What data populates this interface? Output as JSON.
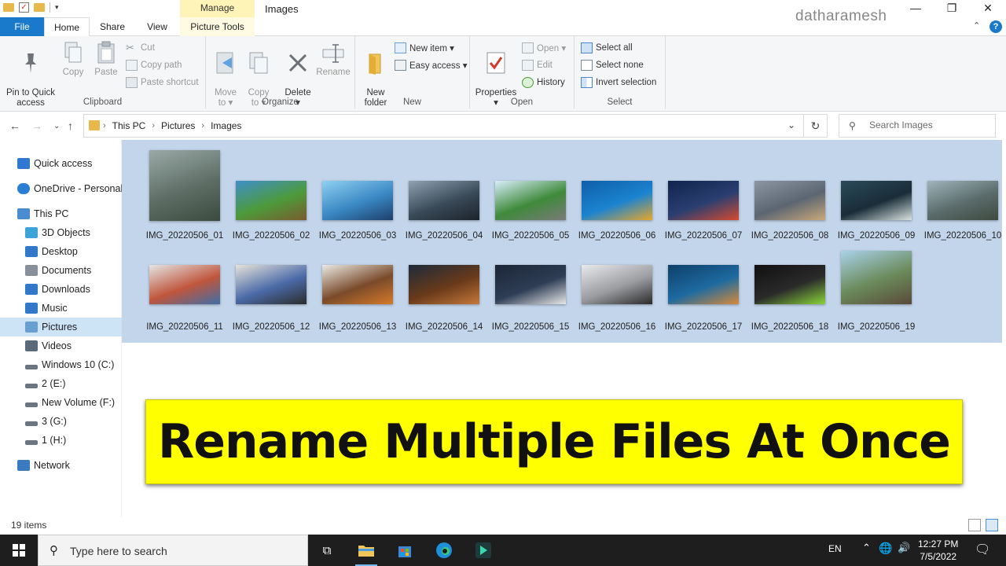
{
  "window": {
    "title": "Images",
    "contextual_group": "Manage",
    "watermark": "datharamesh",
    "minimize": "—",
    "maximize": "❐",
    "close": "✕"
  },
  "tabs": {
    "file": "File",
    "home": "Home",
    "share": "Share",
    "view": "View",
    "picture_tools": "Picture Tools"
  },
  "ribbon": {
    "clipboard": {
      "label": "Clipboard",
      "pin": "Pin to Quick\naccess",
      "copy": "Copy",
      "paste": "Paste",
      "cut": "Cut",
      "copy_path": "Copy path",
      "paste_shortcut": "Paste shortcut"
    },
    "organize": {
      "label": "Organize",
      "move_to": "Move\nto ▾",
      "copy_to": "Copy\nto ▾",
      "delete": "Delete\n▾",
      "rename": "Rename"
    },
    "new": {
      "label": "New",
      "new_folder": "New\nfolder",
      "new_item": "New item ▾",
      "easy_access": "Easy access ▾"
    },
    "open": {
      "label": "Open",
      "properties": "Properties\n▾",
      "open": "Open ▾",
      "edit": "Edit",
      "history": "History"
    },
    "select": {
      "label": "Select",
      "select_all": "Select all",
      "select_none": "Select none",
      "invert": "Invert selection"
    }
  },
  "address": {
    "crumbs": [
      "This PC",
      "Pictures",
      "Images"
    ],
    "search_placeholder": "Search Images"
  },
  "nav_pane": [
    {
      "label": "Quick access",
      "icon": "star-icon",
      "indent": 0,
      "selected": false
    },
    {
      "label": "OneDrive - Personal",
      "icon": "cloud-icon",
      "indent": 0,
      "selected": false
    },
    {
      "label": "This PC",
      "icon": "computer-icon",
      "indent": 0,
      "selected": false
    },
    {
      "label": "3D Objects",
      "icon": "cube-icon",
      "indent": 1,
      "selected": false
    },
    {
      "label": "Desktop",
      "icon": "desktop-icon",
      "indent": 1,
      "selected": false
    },
    {
      "label": "Documents",
      "icon": "document-icon",
      "indent": 1,
      "selected": false
    },
    {
      "label": "Downloads",
      "icon": "download-icon",
      "indent": 1,
      "selected": false
    },
    {
      "label": "Music",
      "icon": "music-icon",
      "indent": 1,
      "selected": false
    },
    {
      "label": "Pictures",
      "icon": "pictures-icon",
      "indent": 1,
      "selected": true
    },
    {
      "label": "Videos",
      "icon": "video-icon",
      "indent": 1,
      "selected": false
    },
    {
      "label": "Windows 10 (C:)",
      "icon": "drive-icon",
      "indent": 1,
      "selected": false
    },
    {
      "label": "2 (E:)",
      "icon": "drive-icon",
      "indent": 1,
      "selected": false
    },
    {
      "label": "New Volume (F:)",
      "icon": "drive-icon",
      "indent": 1,
      "selected": false
    },
    {
      "label": "3 (G:)",
      "icon": "drive-icon",
      "indent": 1,
      "selected": false
    },
    {
      "label": "1 (H:)",
      "icon": "drive-icon",
      "indent": 1,
      "selected": false
    },
    {
      "label": "Network",
      "icon": "network-icon",
      "indent": 0,
      "selected": false
    }
  ],
  "files": [
    {
      "name": "IMG_20220506_01",
      "palette": [
        "#9aa9a6",
        "#5e6e66",
        "#3b4a3e"
      ],
      "portrait": true
    },
    {
      "name": "IMG_20220506_02",
      "palette": [
        "#3f8fc9",
        "#4d9a3a",
        "#7a5a2e"
      ],
      "portrait": false
    },
    {
      "name": "IMG_20220506_03",
      "palette": [
        "#8fd0f2",
        "#3a88c4",
        "#1d3f6b"
      ],
      "portrait": false
    },
    {
      "name": "IMG_20220506_04",
      "palette": [
        "#8ea2b2",
        "#3a4a58",
        "#1b232b"
      ],
      "portrait": false
    },
    {
      "name": "IMG_20220506_05",
      "palette": [
        "#d8eefb",
        "#3f8a3a",
        "#7a7a7a"
      ],
      "portrait": false
    },
    {
      "name": "IMG_20220506_06",
      "palette": [
        "#0f5fa8",
        "#1b83d0",
        "#e7a72a"
      ],
      "portrait": false
    },
    {
      "name": "IMG_20220506_07",
      "palette": [
        "#10244d",
        "#2a3f70",
        "#d64a2f"
      ],
      "portrait": false
    },
    {
      "name": "IMG_20220506_08",
      "palette": [
        "#8c96a2",
        "#5c6672",
        "#c9a87a"
      ],
      "portrait": false
    },
    {
      "name": "IMG_20220506_09",
      "palette": [
        "#2a4a5a",
        "#1a2d38",
        "#d8e2e0"
      ],
      "portrait": false
    },
    {
      "name": "IMG_20220506_10",
      "palette": [
        "#9fb4bc",
        "#5a6b6a",
        "#3e4a40"
      ],
      "portrait": false
    },
    {
      "name": "IMG_20220506_11",
      "palette": [
        "#e5e5e5",
        "#c0563c",
        "#3f6ea8"
      ],
      "portrait": false
    },
    {
      "name": "IMG_20220506_12",
      "palette": [
        "#e6e3da",
        "#4a6aa8",
        "#2c2c2c"
      ],
      "portrait": false
    },
    {
      "name": "IMG_20220506_13",
      "palette": [
        "#eaeae4",
        "#7a4a2a",
        "#d67a2a"
      ],
      "portrait": false
    },
    {
      "name": "IMG_20220506_14",
      "palette": [
        "#1c2a3a",
        "#6a3a1a",
        "#c6783a"
      ],
      "portrait": false
    },
    {
      "name": "IMG_20220506_15",
      "palette": [
        "#1b2536",
        "#2e3d55",
        "#e8e8e8"
      ],
      "portrait": false
    },
    {
      "name": "IMG_20220506_16",
      "palette": [
        "#e9eaec",
        "#9a9ca0",
        "#2a2a2a"
      ],
      "portrait": false
    },
    {
      "name": "IMG_20220506_17",
      "palette": [
        "#0f3f6a",
        "#1d6aa0",
        "#d68a3a"
      ],
      "portrait": false
    },
    {
      "name": "IMG_20220506_18",
      "palette": [
        "#101010",
        "#2a2a2a",
        "#8ad43a"
      ],
      "portrait": false
    },
    {
      "name": "IMG_20220506_19",
      "palette": [
        "#a9d2ea",
        "#6a8a5a",
        "#5a4a3a"
      ],
      "portrait": true
    }
  ],
  "banner": {
    "text": "Rename Multiple Files At Once"
  },
  "status": {
    "count": "19 items"
  },
  "taskbar": {
    "search_placeholder": "Type here to search",
    "lang": "EN",
    "time": "12:27 PM",
    "date": "7/5/2022"
  }
}
